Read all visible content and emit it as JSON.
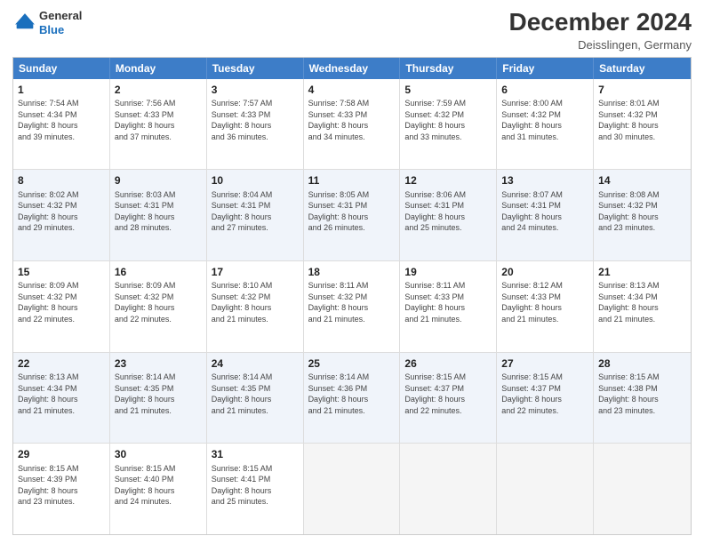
{
  "logo": {
    "line1": "General",
    "line2": "Blue"
  },
  "title": "December 2024",
  "subtitle": "Deisslingen, Germany",
  "header": {
    "days": [
      "Sunday",
      "Monday",
      "Tuesday",
      "Wednesday",
      "Thursday",
      "Friday",
      "Saturday"
    ]
  },
  "rows": [
    {
      "alt": false,
      "cells": [
        {
          "day": "1",
          "info": "Sunrise: 7:54 AM\nSunset: 4:34 PM\nDaylight: 8 hours\nand 39 minutes."
        },
        {
          "day": "2",
          "info": "Sunrise: 7:56 AM\nSunset: 4:33 PM\nDaylight: 8 hours\nand 37 minutes."
        },
        {
          "day": "3",
          "info": "Sunrise: 7:57 AM\nSunset: 4:33 PM\nDaylight: 8 hours\nand 36 minutes."
        },
        {
          "day": "4",
          "info": "Sunrise: 7:58 AM\nSunset: 4:33 PM\nDaylight: 8 hours\nand 34 minutes."
        },
        {
          "day": "5",
          "info": "Sunrise: 7:59 AM\nSunset: 4:32 PM\nDaylight: 8 hours\nand 33 minutes."
        },
        {
          "day": "6",
          "info": "Sunrise: 8:00 AM\nSunset: 4:32 PM\nDaylight: 8 hours\nand 31 minutes."
        },
        {
          "day": "7",
          "info": "Sunrise: 8:01 AM\nSunset: 4:32 PM\nDaylight: 8 hours\nand 30 minutes."
        }
      ]
    },
    {
      "alt": true,
      "cells": [
        {
          "day": "8",
          "info": "Sunrise: 8:02 AM\nSunset: 4:32 PM\nDaylight: 8 hours\nand 29 minutes."
        },
        {
          "day": "9",
          "info": "Sunrise: 8:03 AM\nSunset: 4:31 PM\nDaylight: 8 hours\nand 28 minutes."
        },
        {
          "day": "10",
          "info": "Sunrise: 8:04 AM\nSunset: 4:31 PM\nDaylight: 8 hours\nand 27 minutes."
        },
        {
          "day": "11",
          "info": "Sunrise: 8:05 AM\nSunset: 4:31 PM\nDaylight: 8 hours\nand 26 minutes."
        },
        {
          "day": "12",
          "info": "Sunrise: 8:06 AM\nSunset: 4:31 PM\nDaylight: 8 hours\nand 25 minutes."
        },
        {
          "day": "13",
          "info": "Sunrise: 8:07 AM\nSunset: 4:31 PM\nDaylight: 8 hours\nand 24 minutes."
        },
        {
          "day": "14",
          "info": "Sunrise: 8:08 AM\nSunset: 4:32 PM\nDaylight: 8 hours\nand 23 minutes."
        }
      ]
    },
    {
      "alt": false,
      "cells": [
        {
          "day": "15",
          "info": "Sunrise: 8:09 AM\nSunset: 4:32 PM\nDaylight: 8 hours\nand 22 minutes."
        },
        {
          "day": "16",
          "info": "Sunrise: 8:09 AM\nSunset: 4:32 PM\nDaylight: 8 hours\nand 22 minutes."
        },
        {
          "day": "17",
          "info": "Sunrise: 8:10 AM\nSunset: 4:32 PM\nDaylight: 8 hours\nand 21 minutes."
        },
        {
          "day": "18",
          "info": "Sunrise: 8:11 AM\nSunset: 4:32 PM\nDaylight: 8 hours\nand 21 minutes."
        },
        {
          "day": "19",
          "info": "Sunrise: 8:11 AM\nSunset: 4:33 PM\nDaylight: 8 hours\nand 21 minutes."
        },
        {
          "day": "20",
          "info": "Sunrise: 8:12 AM\nSunset: 4:33 PM\nDaylight: 8 hours\nand 21 minutes."
        },
        {
          "day": "21",
          "info": "Sunrise: 8:13 AM\nSunset: 4:34 PM\nDaylight: 8 hours\nand 21 minutes."
        }
      ]
    },
    {
      "alt": true,
      "cells": [
        {
          "day": "22",
          "info": "Sunrise: 8:13 AM\nSunset: 4:34 PM\nDaylight: 8 hours\nand 21 minutes."
        },
        {
          "day": "23",
          "info": "Sunrise: 8:14 AM\nSunset: 4:35 PM\nDaylight: 8 hours\nand 21 minutes."
        },
        {
          "day": "24",
          "info": "Sunrise: 8:14 AM\nSunset: 4:35 PM\nDaylight: 8 hours\nand 21 minutes."
        },
        {
          "day": "25",
          "info": "Sunrise: 8:14 AM\nSunset: 4:36 PM\nDaylight: 8 hours\nand 21 minutes."
        },
        {
          "day": "26",
          "info": "Sunrise: 8:15 AM\nSunset: 4:37 PM\nDaylight: 8 hours\nand 22 minutes."
        },
        {
          "day": "27",
          "info": "Sunrise: 8:15 AM\nSunset: 4:37 PM\nDaylight: 8 hours\nand 22 minutes."
        },
        {
          "day": "28",
          "info": "Sunrise: 8:15 AM\nSunset: 4:38 PM\nDaylight: 8 hours\nand 23 minutes."
        }
      ]
    },
    {
      "alt": false,
      "cells": [
        {
          "day": "29",
          "info": "Sunrise: 8:15 AM\nSunset: 4:39 PM\nDaylight: 8 hours\nand 23 minutes."
        },
        {
          "day": "30",
          "info": "Sunrise: 8:15 AM\nSunset: 4:40 PM\nDaylight: 8 hours\nand 24 minutes."
        },
        {
          "day": "31",
          "info": "Sunrise: 8:15 AM\nSunset: 4:41 PM\nDaylight: 8 hours\nand 25 minutes."
        },
        {
          "day": "",
          "info": ""
        },
        {
          "day": "",
          "info": ""
        },
        {
          "day": "",
          "info": ""
        },
        {
          "day": "",
          "info": ""
        }
      ]
    }
  ]
}
